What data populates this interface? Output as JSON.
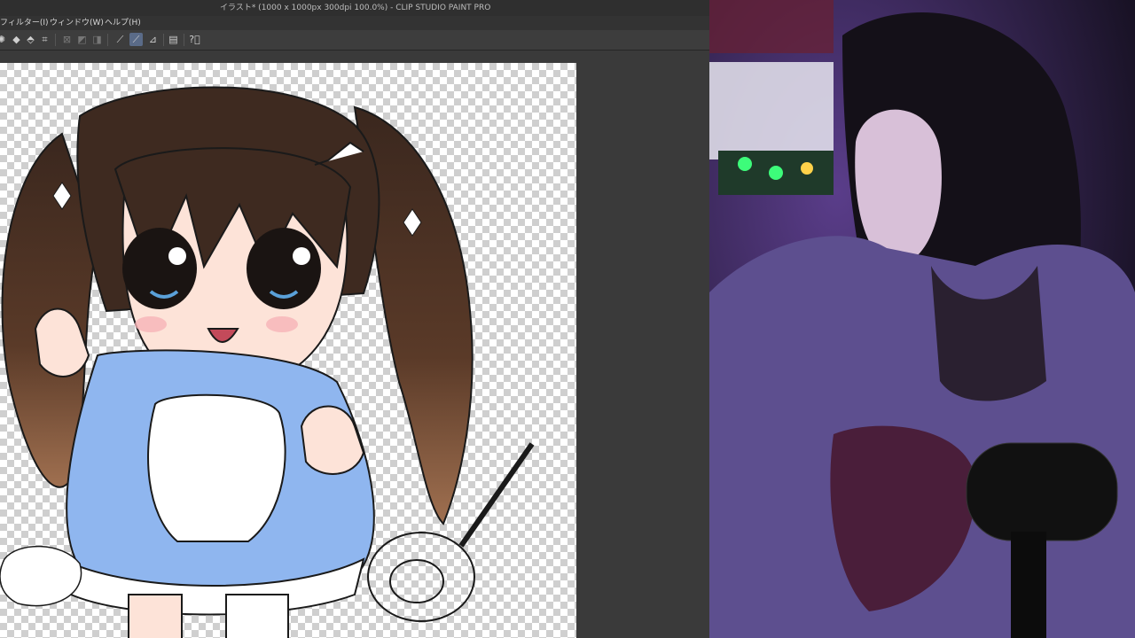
{
  "app": {
    "title": "イラスト* (1000 x 1000px 300dpi 100.0%) - CLIP STUDIO PAINT PRO",
    "menus": [
      "フィルター(I)",
      "ウィンドウ(W)",
      "ヘルプ(H)"
    ]
  },
  "toolbar": {
    "icons": [
      "settings-icon",
      "fill-icon",
      "fill-alt-icon",
      "crop-icon",
      "pen-icon",
      "brush-icon",
      "eraser-icon",
      "square-icon",
      "line-icon",
      "curve-icon",
      "ruler-icon",
      "layer-icon",
      "help-icon"
    ],
    "active_tool": "curve-icon"
  },
  "colors": {
    "app_bg": "#3a3a3a",
    "titlebar": "#2f2f2f",
    "menubar": "#333333",
    "active_tool_bg": "#5a6b88",
    "hair": "#3e2a20",
    "dress": "#8fb6ef",
    "webcam_glow": "#5a3d8a"
  }
}
